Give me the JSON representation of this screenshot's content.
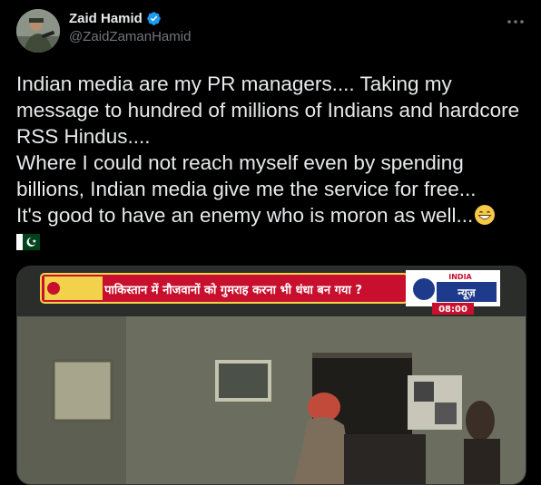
{
  "author": {
    "display_name": "Zaid Hamid",
    "handle": "@ZaidZamanHamid",
    "verified": true,
    "avatar_icon": "profile-photo"
  },
  "icons": {
    "more": "more-options-icon",
    "verified": "verified-badge-icon"
  },
  "tweet": {
    "lines": [
      "Indian media are my PR managers.... Taking my",
      "message to hundred of millions of Indians and hardcore",
      "RSS Hindus....",
      "Where I could not reach myself even by spending",
      "billions, Indian media give me the service for free...",
      "It's good to have an enemy who is moron as well..."
    ],
    "emoji_end": "grinning-face-with-smiling-eyes",
    "flag": "pakistan-flag"
  },
  "media": {
    "type": "video-still",
    "ticker_text": "पाकिस्तान में नौजवानों को गुमराह करना भी धंधा बन गया ?",
    "channel_logo_top": "INDIA",
    "channel_logo_main": "न्यूज़",
    "clock": "08:00"
  },
  "colors": {
    "background": "#000000",
    "text": "#e7e9ea",
    "secondary": "#71767b",
    "verified": "#1d9bf0",
    "ticker_bg": "#c8102e",
    "ticker_text": "#ffffff",
    "logo_blue": "#1e3a8a"
  }
}
